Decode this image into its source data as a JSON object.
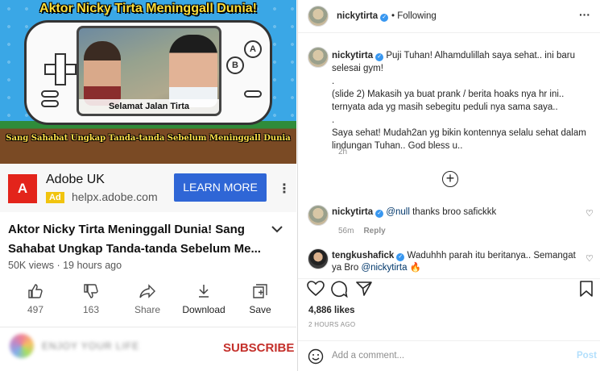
{
  "youtube": {
    "thumbnail": {
      "title": "Aktor Nicky Tirta Meninggall Dunia!",
      "caption": "Selamat Jalan Tirta",
      "subtitle": "Sang Sahabat Ungkap Tanda-tanda Sebelum Meninggall Dunia",
      "console_buttons": [
        "A",
        "B"
      ]
    },
    "ad": {
      "logo_text": "A",
      "advertiser": "Adobe UK",
      "badge": "Ad",
      "domain": "helpx.adobe.com",
      "cta": "LEARN MORE",
      "more_icon": "⋮"
    },
    "video": {
      "title": "Aktor Nicky Tirta Meninggall Dunia! Sang Sahabat Ungkap Tanda-tanda Sebelum Me...",
      "meta": "50K views · 19 hours ago"
    },
    "actions": {
      "like_count": "497",
      "dislike_count": "163",
      "share": "Share",
      "download": "Download",
      "save": "Save"
    },
    "channel": {
      "name": "ENJOY YOUR LIFE",
      "subscribe": "SUBSCRIBE"
    }
  },
  "instagram": {
    "header": {
      "username": "nickytirta",
      "following": "Following",
      "more_icon": "···"
    },
    "caption": {
      "username": "nickytirta",
      "lines": [
        "Puji Tuhan! Alhamdulillah saya sehat.. ini baru selesai gym!",
        ".",
        "(slide 2) Makasih ya buat prank / berita hoaks nya hr ini.. ternyata ada yg masih sebegitu peduli nya sama saya..",
        ".",
        "Saya sehat! Mudah2an yg bikin kontennya selalu sehat dalam lindungan Tuhan.. God bless u.."
      ],
      "time": "2h"
    },
    "comments": [
      {
        "username": "nickytirta",
        "mention": "@null",
        "text": " thanks broo safickkk",
        "time": "56m",
        "reply": "Reply"
      },
      {
        "username": "tengkushafick",
        "text": "Waduhhh parah itu beritanya.. Semangat ya Bro ",
        "mention": "@nickytirta",
        "emoji": "🔥"
      }
    ],
    "likes": "4,886 likes",
    "posted": "2 HOURS AGO",
    "add_comment": {
      "placeholder": "Add a comment...",
      "post": "Post"
    }
  }
}
